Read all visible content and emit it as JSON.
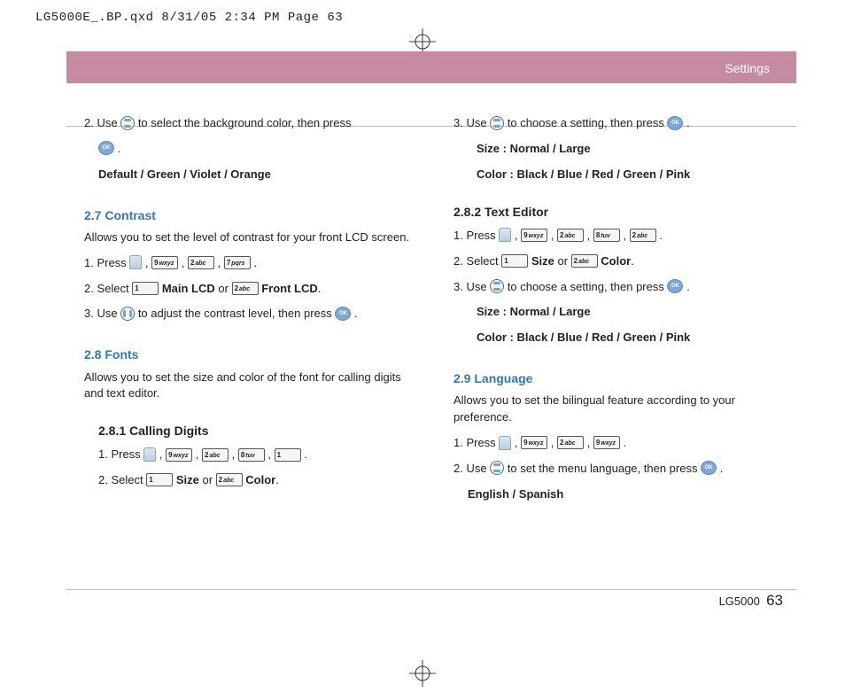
{
  "proof_mark": "LG5000E_.BP.qxd  8/31/05  2:34 PM  Page 63",
  "header": "Settings",
  "footer": {
    "model": "LG5000",
    "page": "63"
  },
  "left": {
    "bgcolor_step": "2. Use ",
    "bgcolor_step_b": " to select the background color, then press ",
    "bgcolor_opts": "Default / Green / Violet / Orange",
    "contrast_h": "2.7 Contrast",
    "contrast_desc": "Allows you to set the level of contrast for your front LCD screen.",
    "contrast_s1a": "1. Press ",
    "contrast_s2a": "2. Select  ",
    "contrast_s2b": "  Main LCD",
    "contrast_s2c": " or  ",
    "contrast_s2d": "  Front LCD",
    "contrast_s3a": "3. Use  ",
    "contrast_s3b": " to adjust the contrast level, then press ",
    "fonts_h": "2.8 Fonts",
    "fonts_desc": "Allows you to set the size and color of the font for calling digits and text editor.",
    "cd_h": "2.8.1 Calling Digits",
    "cd_s1": "1. Press ",
    "cd_s2a": "2. Select  ",
    "cd_s2b": "  Size",
    "cd_s2c": " or  ",
    "cd_s2d": "  Color"
  },
  "right": {
    "cd_s3a": "3. Use ",
    "cd_s3b": " to choose a setting, then press ",
    "size_line_a": "Size : ",
    "size_line_b": "Normal / Large",
    "color_line_a": "Color : ",
    "color_line_b": "Black / Blue / Red / Green / Pink",
    "te_h": "2.8.2 Text Editor",
    "te_s1": "1. Press ",
    "te_s2a": "2. Select  ",
    "te_s2b": "  Size",
    "te_s2c": " or  ",
    "te_s2d": "  Color",
    "te_s3a": "3. Use ",
    "te_s3b": " to choose a setting, then press ",
    "lang_h": "2.9 Language",
    "lang_desc": "Allows you to set the bilingual feature according to your preference.",
    "lang_s1": "1. Press ",
    "lang_s2a": "2. Use  ",
    "lang_s2b": " to set the menu language, then press ",
    "lang_opts": "English / Spanish"
  },
  "keys": {
    "k1": "1",
    "k2": "2 abc",
    "k7": "7 pqrs",
    "k8": "8 tuv",
    "k9": "9 wxyz"
  }
}
